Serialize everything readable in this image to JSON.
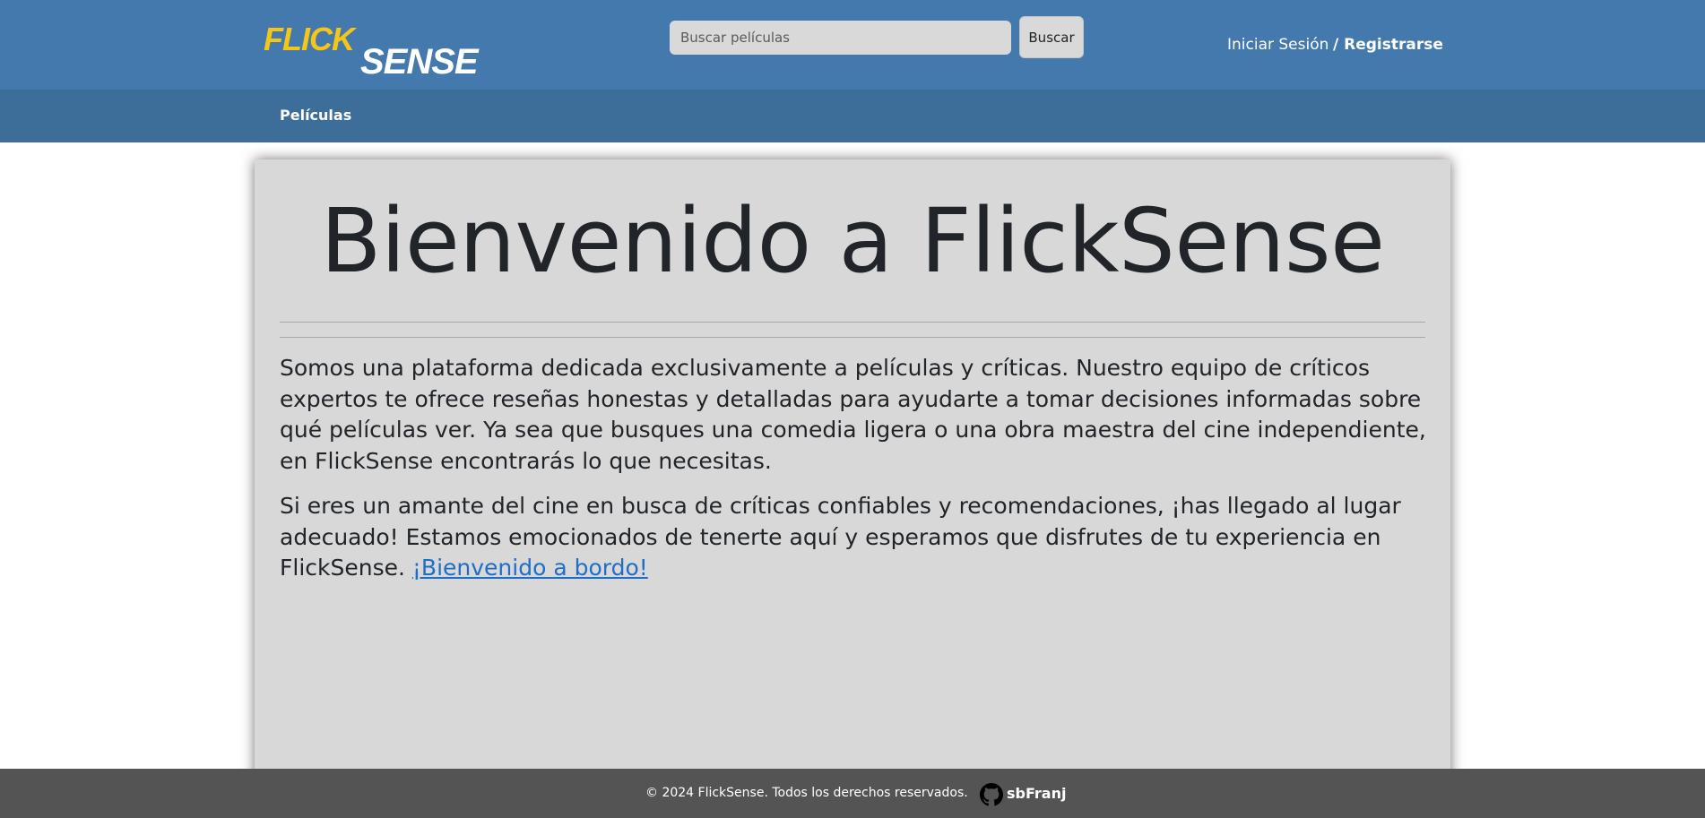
{
  "header": {
    "logo": {
      "part1": "FLICK",
      "part2": "SENSE",
      "colors": {
        "flick": "#f5c518",
        "sense": "#ffffff"
      }
    },
    "search": {
      "placeholder": "Buscar películas",
      "button_label": "Buscar"
    },
    "auth": {
      "login_label": "Iniciar Sesión",
      "register_label": "/ Registrarse"
    }
  },
  "nav": {
    "items": [
      {
        "label": "Películas"
      }
    ]
  },
  "main": {
    "title": "Bienvenido a FlickSense",
    "paragraph1": "Somos una plataforma dedicada exclusivamente a películas y críticas. Nuestro equipo de críticos expertos te ofrece reseñas honestas y detalladas para ayudarte a tomar decisiones informadas sobre qué películas ver. Ya sea que busques una comedia ligera o una obra maestra del cine independiente, en FlickSense encontrarás lo que necesitas.",
    "paragraph2": "Si eres un amante del cine en busca de críticas confiables y recomendaciones, ¡has llegado al lugar adecuado! Estamos emocionados de tenerte aquí y esperamos que disfrutes de tu experiencia en FlickSense.",
    "link_text": "¡Bienvenido a bordo!"
  },
  "footer": {
    "copyright": "© 2024 FlickSense. Todos los derechos reservados.",
    "github_icon": "github-icon",
    "github_user": "sbFranj"
  },
  "colors": {
    "header_bg": "#4479ad",
    "subnav_bg": "#3c6e99",
    "card_bg": "#d8d8d8",
    "footer_bg": "#545454",
    "link": "#1e6ec8"
  }
}
